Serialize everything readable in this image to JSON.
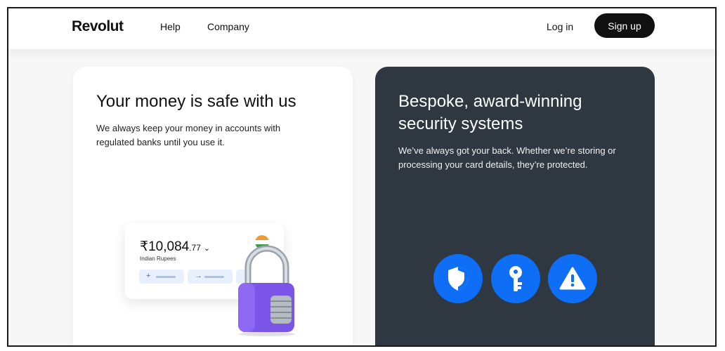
{
  "header": {
    "logo": "Revolut",
    "nav": {
      "help": "Help",
      "company": "Company"
    },
    "login": "Log in",
    "signup": "Sign up"
  },
  "left_card": {
    "title": "Your money is safe with us",
    "description": "We always keep your money in accounts with regulated banks until you use it.",
    "balance": {
      "amount_main": "₹10,084",
      "amount_cents": ".77",
      "currency_name": "Indian Rupees",
      "actions": [
        {
          "symbol": "+"
        },
        {
          "symbol": "→"
        }
      ]
    }
  },
  "right_card": {
    "title": "Bespoke, award-winning security systems",
    "description": "We’ve always got your back. Whether we’re storing or processing your card details, they’re protected.",
    "icons": [
      "shield-icon",
      "key-icon",
      "warning-icon"
    ]
  },
  "colors": {
    "accent": "#0e6ef5",
    "dark_card": "#2f3740",
    "lock_purple": "#7b54e8"
  }
}
